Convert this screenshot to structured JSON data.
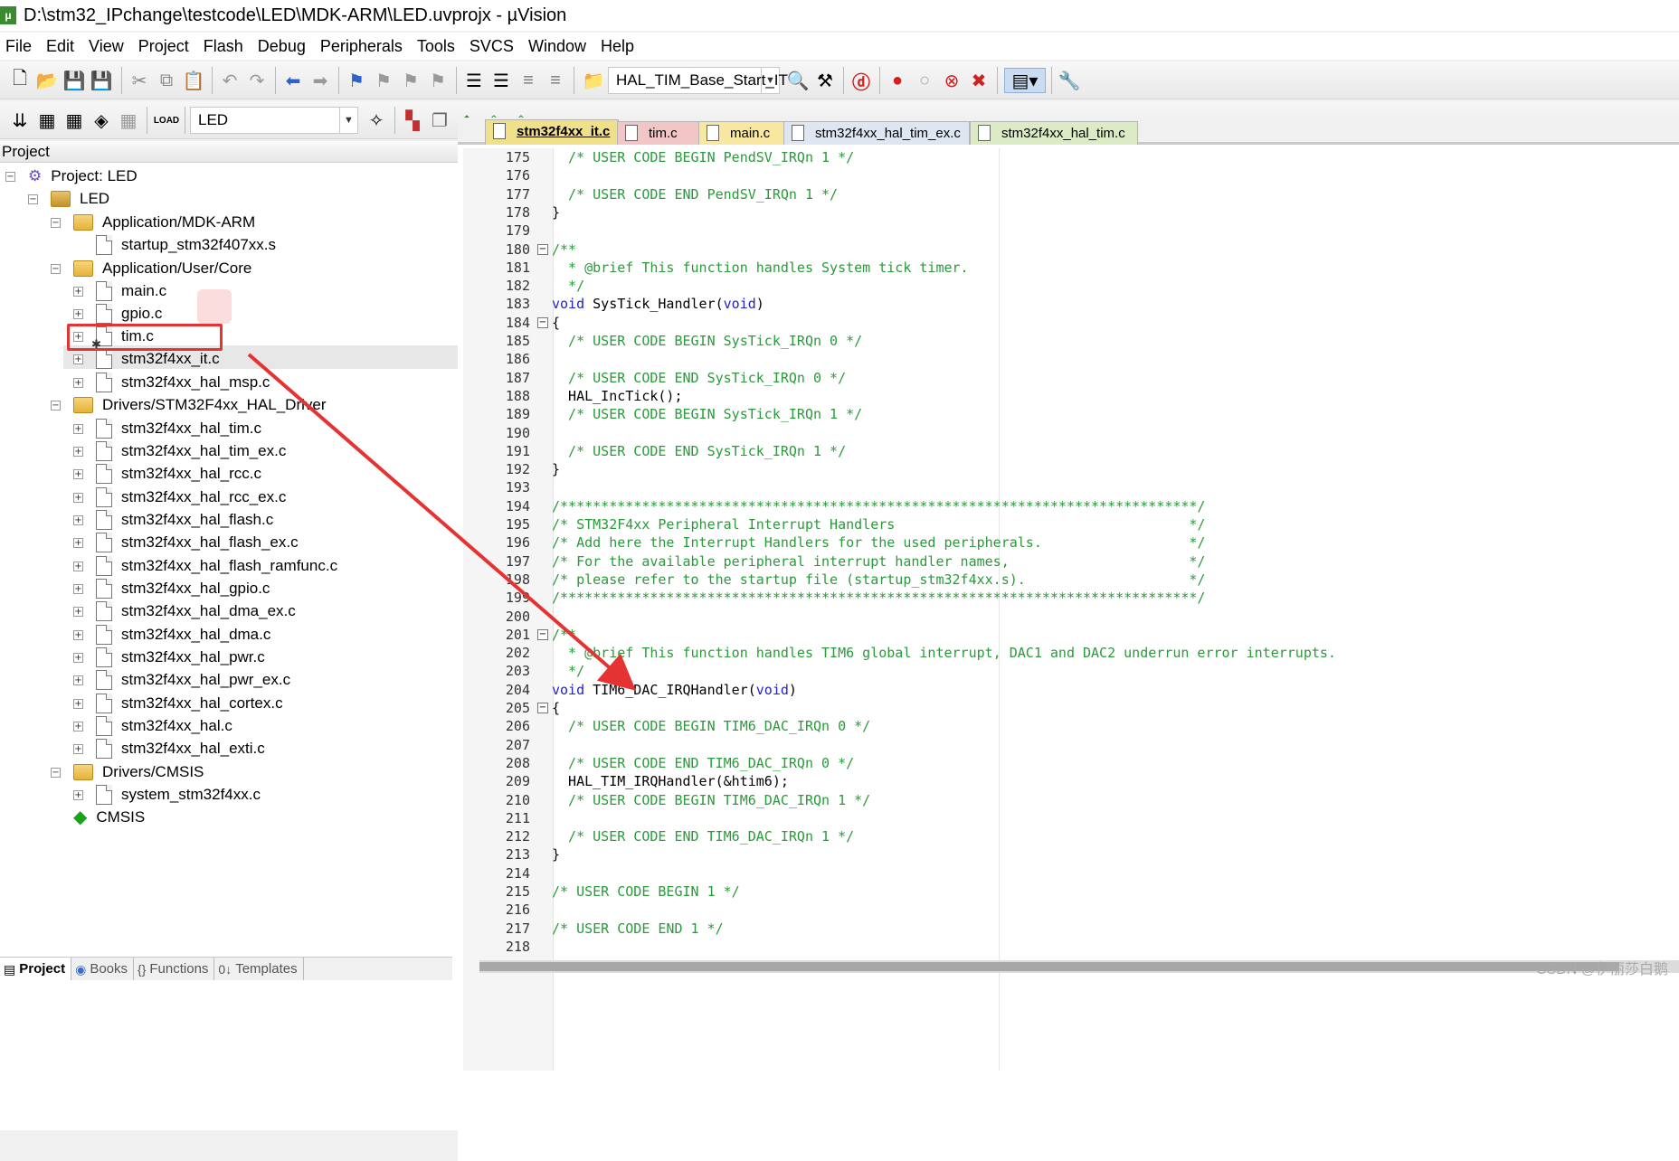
{
  "window": {
    "title": "D:\\stm32_IPchange\\testcode\\LED\\MDK-ARM\\LED.uvprojx - µVision"
  },
  "menu": [
    "File",
    "Edit",
    "View",
    "Project",
    "Flash",
    "Debug",
    "Peripherals",
    "Tools",
    "SVCS",
    "Window",
    "Help"
  ],
  "toolbar": {
    "find_combo": "HAL_TIM_Base_Start_IT",
    "target_combo": "LED"
  },
  "project_panel": {
    "title": "Project",
    "tree": [
      {
        "label": "Project: LED",
        "type": "root"
      },
      {
        "label": "LED",
        "type": "target"
      },
      {
        "label": "Application/MDK-ARM",
        "type": "folder"
      },
      {
        "label": "startup_stm32f407xx.s",
        "type": "file"
      },
      {
        "label": "Application/User/Core",
        "type": "folder"
      },
      {
        "label": "main.c",
        "type": "file"
      },
      {
        "label": "gpio.c",
        "type": "file"
      },
      {
        "label": "tim.c",
        "type": "file"
      },
      {
        "label": "stm32f4xx_it.c",
        "type": "file"
      },
      {
        "label": "stm32f4xx_hal_msp.c",
        "type": "file"
      },
      {
        "label": "Drivers/STM32F4xx_HAL_Driver",
        "type": "folder"
      },
      {
        "label": "stm32f4xx_hal_tim.c",
        "type": "file"
      },
      {
        "label": "stm32f4xx_hal_tim_ex.c",
        "type": "file"
      },
      {
        "label": "stm32f4xx_hal_rcc.c",
        "type": "file"
      },
      {
        "label": "stm32f4xx_hal_rcc_ex.c",
        "type": "file"
      },
      {
        "label": "stm32f4xx_hal_flash.c",
        "type": "file"
      },
      {
        "label": "stm32f4xx_hal_flash_ex.c",
        "type": "file"
      },
      {
        "label": "stm32f4xx_hal_flash_ramfunc.c",
        "type": "file"
      },
      {
        "label": "stm32f4xx_hal_gpio.c",
        "type": "file"
      },
      {
        "label": "stm32f4xx_hal_dma_ex.c",
        "type": "file"
      },
      {
        "label": "stm32f4xx_hal_dma.c",
        "type": "file"
      },
      {
        "label": "stm32f4xx_hal_pwr.c",
        "type": "file"
      },
      {
        "label": "stm32f4xx_hal_pwr_ex.c",
        "type": "file"
      },
      {
        "label": "stm32f4xx_hal_cortex.c",
        "type": "file"
      },
      {
        "label": "stm32f4xx_hal.c",
        "type": "file"
      },
      {
        "label": "stm32f4xx_hal_exti.c",
        "type": "file"
      },
      {
        "label": "Drivers/CMSIS",
        "type": "folder"
      },
      {
        "label": "system_stm32f4xx.c",
        "type": "file"
      },
      {
        "label": "CMSIS",
        "type": "component"
      }
    ],
    "bottom_tabs": [
      "Project",
      "Books",
      "Functions",
      "Templates"
    ]
  },
  "editor": {
    "tabs": [
      {
        "label": "stm32f4xx_it.c",
        "active": true,
        "color": "#f1e08a"
      },
      {
        "label": "tim.c",
        "active": false,
        "color": "#f2c6c6"
      },
      {
        "label": "main.c",
        "active": false,
        "color": "#f7e7a1"
      },
      {
        "label": "stm32f4xx_hal_tim_ex.c",
        "active": false,
        "color": "#dde6f1"
      },
      {
        "label": "stm32f4xx_hal_tim.c",
        "active": false,
        "color": "#dcebc5"
      }
    ],
    "lines": [
      {
        "n": "175",
        "t": "  /* USER CODE BEGIN PendSV_IRQn 1 */",
        "k": "comment"
      },
      {
        "n": "176",
        "t": "",
        "k": "plain"
      },
      {
        "n": "177",
        "t": "  /* USER CODE END PendSV_IRQn 1 */",
        "k": "comment"
      },
      {
        "n": "178",
        "t": "}",
        "k": "plain"
      },
      {
        "n": "179",
        "t": "",
        "k": "plain"
      },
      {
        "n": "180",
        "t": "/**",
        "k": "comment",
        "fold": true
      },
      {
        "n": "181",
        "t": "  * @brief This function handles System tick timer.",
        "k": "comment"
      },
      {
        "n": "182",
        "t": "  */",
        "k": "comment"
      },
      {
        "n": "183",
        "t": "void SysTick_Handler(void)",
        "k": "func"
      },
      {
        "n": "184",
        "t": "{",
        "k": "plain",
        "fold": true
      },
      {
        "n": "185",
        "t": "  /* USER CODE BEGIN SysTick_IRQn 0 */",
        "k": "comment"
      },
      {
        "n": "186",
        "t": "",
        "k": "plain"
      },
      {
        "n": "187",
        "t": "  /* USER CODE END SysTick_IRQn 0 */",
        "k": "comment"
      },
      {
        "n": "188",
        "t": "  HAL_IncTick();",
        "k": "plain"
      },
      {
        "n": "189",
        "t": "  /* USER CODE BEGIN SysTick_IRQn 1 */",
        "k": "comment"
      },
      {
        "n": "190",
        "t": "",
        "k": "plain"
      },
      {
        "n": "191",
        "t": "  /* USER CODE END SysTick_IRQn 1 */",
        "k": "comment"
      },
      {
        "n": "192",
        "t": "}",
        "k": "plain"
      },
      {
        "n": "193",
        "t": "",
        "k": "plain"
      },
      {
        "n": "194",
        "t": "/******************************************************************************/",
        "k": "comment"
      },
      {
        "n": "195",
        "t": "/* STM32F4xx Peripheral Interrupt Handlers                                    */",
        "k": "comment"
      },
      {
        "n": "196",
        "t": "/* Add here the Interrupt Handlers for the used peripherals.                  */",
        "k": "comment"
      },
      {
        "n": "197",
        "t": "/* For the available peripheral interrupt handler names,                      */",
        "k": "comment"
      },
      {
        "n": "198",
        "t": "/* please refer to the startup file (startup_stm32f4xx.s).                    */",
        "k": "comment"
      },
      {
        "n": "199",
        "t": "/******************************************************************************/",
        "k": "comment"
      },
      {
        "n": "200",
        "t": "",
        "k": "plain"
      },
      {
        "n": "201",
        "t": "/**",
        "k": "comment",
        "fold": true
      },
      {
        "n": "202",
        "t": "  * @brief This function handles TIM6 global interrupt, DAC1 and DAC2 underrun error interrupts.",
        "k": "comment"
      },
      {
        "n": "203",
        "t": "  */",
        "k": "comment"
      },
      {
        "n": "204",
        "t": "void TIM6_DAC_IRQHandler(void)",
        "k": "func"
      },
      {
        "n": "205",
        "t": "{",
        "k": "plain",
        "fold": true
      },
      {
        "n": "206",
        "t": "  /* USER CODE BEGIN TIM6_DAC_IRQn 0 */",
        "k": "comment"
      },
      {
        "n": "207",
        "t": "",
        "k": "plain"
      },
      {
        "n": "208",
        "t": "  /* USER CODE END TIM6_DAC_IRQn 0 */",
        "k": "comment"
      },
      {
        "n": "209",
        "t": "  HAL_TIM_IRQHandler(&htim6);",
        "k": "plain"
      },
      {
        "n": "210",
        "t": "  /* USER CODE BEGIN TIM6_DAC_IRQn 1 */",
        "k": "comment"
      },
      {
        "n": "211",
        "t": "",
        "k": "plain"
      },
      {
        "n": "212",
        "t": "  /* USER CODE END TIM6_DAC_IRQn 1 */",
        "k": "comment"
      },
      {
        "n": "213",
        "t": "}",
        "k": "plain"
      },
      {
        "n": "214",
        "t": "",
        "k": "plain"
      },
      {
        "n": "215",
        "t": "/* USER CODE BEGIN 1 */",
        "k": "comment"
      },
      {
        "n": "216",
        "t": "",
        "k": "plain"
      },
      {
        "n": "217",
        "t": "/* USER CODE END 1 */",
        "k": "comment"
      },
      {
        "n": "218",
        "t": "",
        "k": "plain"
      }
    ]
  },
  "watermark": "CSDN @伊丽莎白鹅",
  "colors": {
    "comment": "#2a9a3a",
    "keyword": "#2222cc",
    "annotation": "#e53333"
  }
}
